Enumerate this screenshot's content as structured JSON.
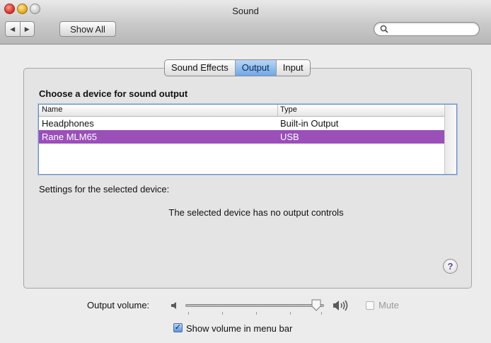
{
  "window": {
    "title": "Sound"
  },
  "toolbar": {
    "back_glyph": "◀",
    "forward_glyph": "▶",
    "show_all_label": "Show All",
    "search_placeholder": "",
    "search_icon": "search-icon"
  },
  "tabs": [
    {
      "label": "Sound Effects",
      "active": false
    },
    {
      "label": "Output",
      "active": true
    },
    {
      "label": "Input",
      "active": false
    }
  ],
  "output": {
    "heading": "Choose a device for sound output",
    "columns": [
      "Name",
      "Type"
    ],
    "devices": [
      {
        "name": "Headphones",
        "type": "Built-in Output",
        "selected": false
      },
      {
        "name": "Rane MLM65",
        "type": "USB",
        "selected": true
      }
    ],
    "settings_label": "Settings for the selected device:",
    "no_controls_text": "The selected device has no output controls",
    "help_label": "?"
  },
  "volume": {
    "label": "Output volume:",
    "level": 0.98,
    "mute_label": "Mute",
    "mute_checked": false,
    "show_in_menubar_label": "Show volume in menu bar",
    "show_in_menubar_checked": true
  },
  "colors": {
    "selection": "#9a4fb9",
    "active_tab": "#6fa6e8"
  }
}
